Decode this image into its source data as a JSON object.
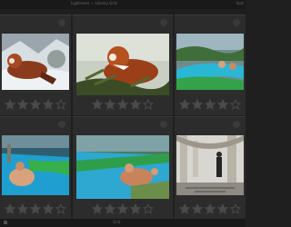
{
  "topbar": {
    "title": "Lightroom — Library Grid",
    "right": "Sort"
  },
  "bottombar": {
    "label": "Grid"
  },
  "accent": "#d84fb3",
  "cells": [
    {
      "rating": 4,
      "image": "red-panda-snow"
    },
    {
      "rating": 4,
      "image": "red-panda-eating",
      "selected": true
    },
    {
      "rating": 4,
      "image": "water-slide-group"
    },
    {
      "rating": 4,
      "image": "water-slide-person"
    },
    {
      "rating": 4,
      "image": "water-slide-tube"
    },
    {
      "rating": 4,
      "image": "colonnade-walker"
    }
  ],
  "max_rating": 5
}
